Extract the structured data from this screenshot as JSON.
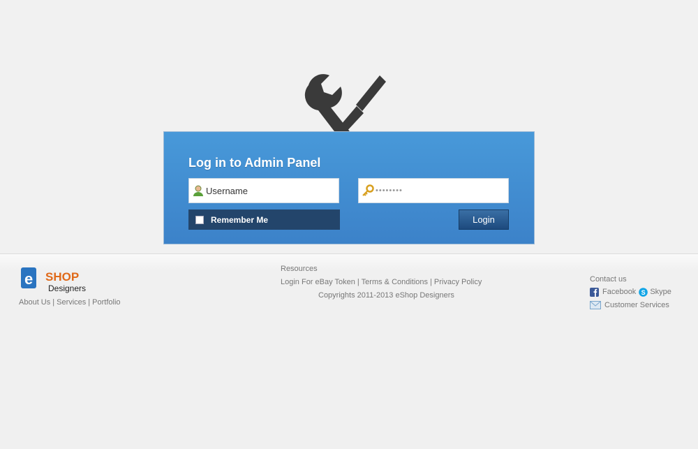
{
  "login": {
    "title": "Log in to Admin Panel",
    "username_placeholder": "Username",
    "password_value": "••••••••",
    "remember_label": "Remember Me",
    "login_button": "Login"
  },
  "footer": {
    "logo": {
      "brand": "SHOP",
      "prefix": "e",
      "sub": "Designers"
    },
    "left_links": [
      "About Us",
      "Services",
      "Portfolio"
    ],
    "center": {
      "heading": "Resources",
      "links": [
        "Login For eBay Token",
        "Terms & Conditions",
        "Privacy Policy"
      ],
      "copyright": "Copyrights 2011-2013 eShop Designers"
    },
    "right": {
      "heading": "Contact us",
      "facebook": "Facebook",
      "skype": "Skype",
      "customer_services": "Customer Services"
    }
  },
  "colors": {
    "panel": "#4393d6",
    "remember_bg": "#23456b",
    "login_btn": "#2a5d93",
    "page_bg": "#f1f1f1"
  }
}
